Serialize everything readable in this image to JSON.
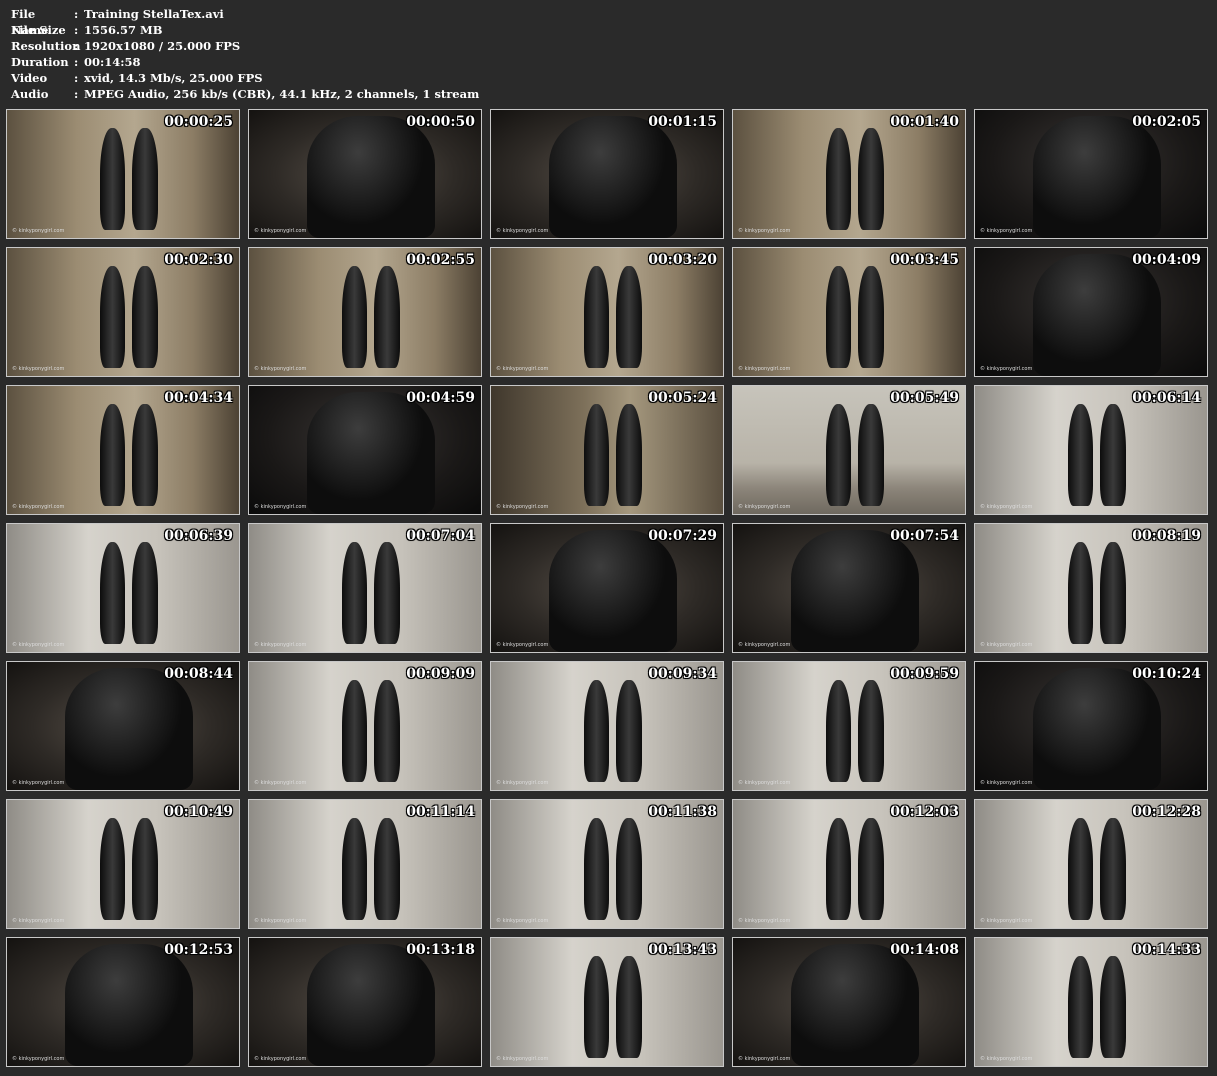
{
  "info": [
    {
      "key": "File Name",
      "value": "Training StellaTex.avi"
    },
    {
      "key": "File Size",
      "value": "1556.57 MB"
    },
    {
      "key": "Resolution",
      "value": "1920x1080 / 25.000 FPS"
    },
    {
      "key": "Duration",
      "value": "00:14:58"
    },
    {
      "key": "Video",
      "value": "xvid, 14.3 Mb/s, 25.000 FPS"
    },
    {
      "key": "Audio",
      "value": "MPEG Audio, 256 kb/s (CBR), 44.1 kHz, 2 channels, 1 stream"
    }
  ],
  "separator": ":",
  "watermark": "© kinkyponygirl.com",
  "thumbnails": [
    {
      "time": "00:00:25",
      "scene": "room"
    },
    {
      "time": "00:00:50",
      "scene": "closeup"
    },
    {
      "time": "00:01:15",
      "scene": "closeup"
    },
    {
      "time": "00:01:40",
      "scene": "room"
    },
    {
      "time": "00:02:05",
      "scene": "dark"
    },
    {
      "time": "00:02:30",
      "scene": "room"
    },
    {
      "time": "00:02:55",
      "scene": "room"
    },
    {
      "time": "00:03:20",
      "scene": "room"
    },
    {
      "time": "00:03:45",
      "scene": "room"
    },
    {
      "time": "00:04:09",
      "scene": "dark"
    },
    {
      "time": "00:04:34",
      "scene": "room"
    },
    {
      "time": "00:04:59",
      "scene": "dark"
    },
    {
      "time": "00:05:24",
      "scene": "barn"
    },
    {
      "time": "00:05:49",
      "scene": "outdoor"
    },
    {
      "time": "00:06:14",
      "scene": "white"
    },
    {
      "time": "00:06:39",
      "scene": "white"
    },
    {
      "time": "00:07:04",
      "scene": "white"
    },
    {
      "time": "00:07:29",
      "scene": "closeup"
    },
    {
      "time": "00:07:54",
      "scene": "closeup"
    },
    {
      "time": "00:08:19",
      "scene": "white"
    },
    {
      "time": "00:08:44",
      "scene": "closeup"
    },
    {
      "time": "00:09:09",
      "scene": "white"
    },
    {
      "time": "00:09:34",
      "scene": "white"
    },
    {
      "time": "00:09:59",
      "scene": "white"
    },
    {
      "time": "00:10:24",
      "scene": "dark"
    },
    {
      "time": "00:10:49",
      "scene": "white"
    },
    {
      "time": "00:11:14",
      "scene": "white"
    },
    {
      "time": "00:11:38",
      "scene": "white"
    },
    {
      "time": "00:12:03",
      "scene": "white"
    },
    {
      "time": "00:12:28",
      "scene": "white"
    },
    {
      "time": "00:12:53",
      "scene": "closeup"
    },
    {
      "time": "00:13:18",
      "scene": "closeup"
    },
    {
      "time": "00:13:43",
      "scene": "white"
    },
    {
      "time": "00:14:08",
      "scene": "closeup"
    },
    {
      "time": "00:14:33",
      "scene": "white"
    }
  ],
  "colors": {
    "background": "#2a2a2a",
    "room": "#8a7a62",
    "dark": "#1c1a18",
    "white": "#bdb9b2",
    "barn": "#6e6250",
    "outdoor": "#a8a49a",
    "closeup": "#3a3632",
    "figure": "#0d0d0d"
  }
}
